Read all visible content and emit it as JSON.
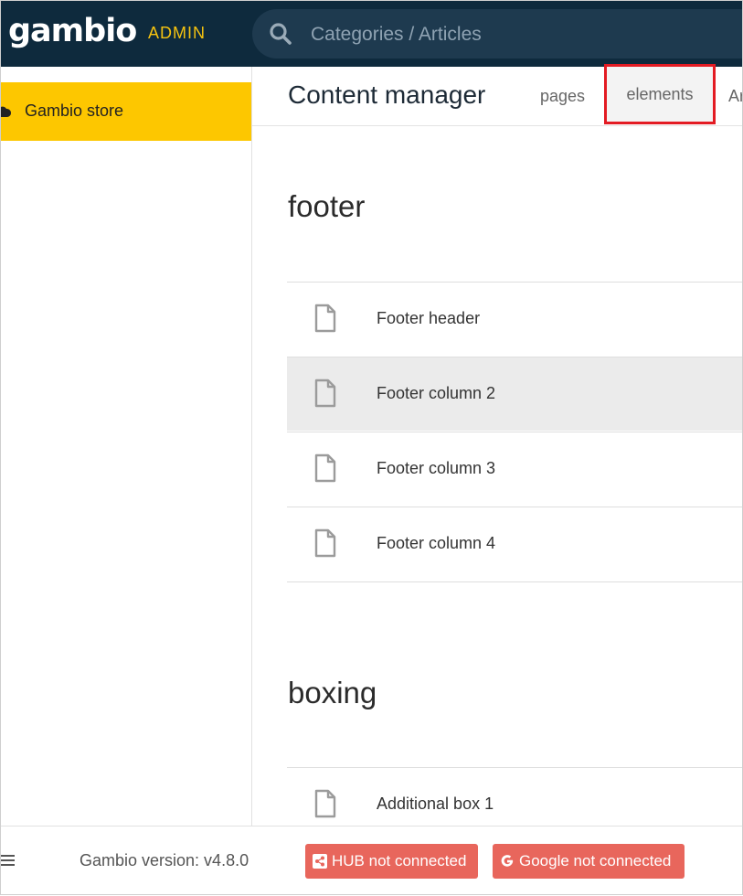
{
  "header": {
    "logo_text": "gambio",
    "admin_label": "ADMIN",
    "search_placeholder": "Categories / Articles",
    "bg_color": "#0e2a3d",
    "admin_color": "#f6c310"
  },
  "sidebar": {
    "items": [
      {
        "label": "Gambio store",
        "icon": "cloud-icon",
        "active": true,
        "color": "#fdc700"
      }
    ]
  },
  "main": {
    "title": "Content manager",
    "tabs": [
      {
        "label": "pages"
      },
      {
        "label": "elements",
        "active": true
      },
      {
        "label": "Ar"
      }
    ],
    "sections": [
      {
        "title": "footer",
        "rows": [
          {
            "label": "Footer header",
            "icon": "document-icon"
          },
          {
            "label": "Footer column 2",
            "icon": "document-icon",
            "hovered": true
          },
          {
            "label": "Footer column 3",
            "icon": "document-icon"
          },
          {
            "label": "Footer column 4",
            "icon": "document-icon"
          }
        ]
      },
      {
        "title": "boxing",
        "rows": [
          {
            "label": "Additional box 1",
            "icon": "document-icon"
          }
        ]
      }
    ]
  },
  "footer": {
    "version_text": "Gambio version: v4.8.0",
    "hub_button": "HUB not connected",
    "google_button": "Google not connected",
    "button_color": "#e8665c"
  }
}
